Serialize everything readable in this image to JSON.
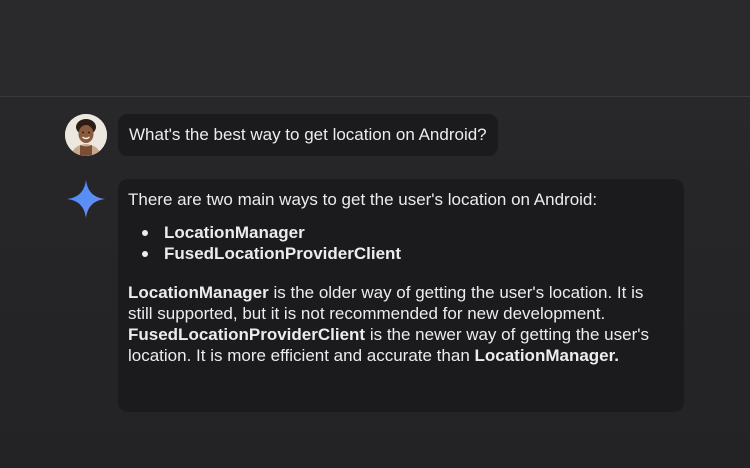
{
  "conversation": {
    "user_message": {
      "text": "What's the best way to get location on Android?"
    },
    "ai_response": {
      "intro": "There are two main ways to get the user's location on Android:",
      "list_items": [
        "LocationManager",
        "FusedLocationProviderClient"
      ],
      "paragraph": {
        "term1": "LocationManager",
        "text1": " is the older way of getting the user's location. It is still supported, but it is not recommended for new development. ",
        "term2": "FusedLocationProviderClient",
        "text2": " is the newer way of getting the user's location. It is more efficient and accurate than ",
        "term3": "LocationManager."
      }
    }
  },
  "icons": {
    "user_avatar": "user-avatar-photo",
    "ai_assistant": "sparkle-icon"
  },
  "colors": {
    "background": "#262628",
    "bubble": "#1b1b1d",
    "text": "#ececef",
    "sparkle_blue": "#4a8cf7",
    "sparkle_violet": "#9b7df2"
  }
}
